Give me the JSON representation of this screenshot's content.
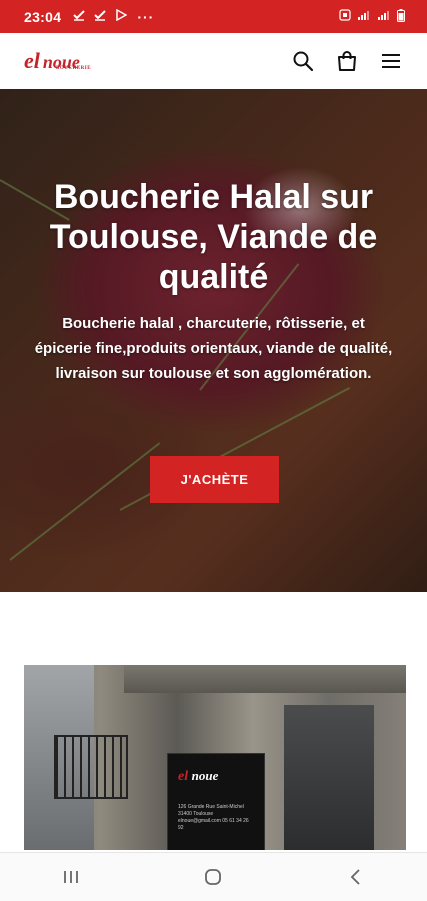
{
  "status_bar": {
    "time": "23:04",
    "more": "···",
    "battery": "🔋"
  },
  "header": {
    "logo": {
      "el": "el",
      "noue": "noue",
      "small": "BOUCHERIE"
    }
  },
  "hero": {
    "title": "Boucherie Halal sur Toulouse, Viande de qualité",
    "subtitle": "Boucherie halal , charcuterie, rôtisserie, et épicerie fine,produits orientaux, viande de qualité, livraison sur toulouse et son agglomération.",
    "cta": "J'ACHÈTE"
  },
  "storefront_sign": {
    "logo_el": "el",
    "logo_noue": "noue",
    "small_text": "126 Grande Rue Saint-Michel 31400 Toulouse elnoue@gmail.com 05 61 34 26 92"
  },
  "icons": {
    "search": "search-icon",
    "cart": "shopping-bag-icon",
    "menu": "hamburger-menu-icon",
    "nav_recents": "recent-apps-icon",
    "nav_home": "home-icon",
    "nav_back": "back-icon"
  },
  "colors": {
    "accent": "#d32323",
    "logo": "#c4232a"
  }
}
